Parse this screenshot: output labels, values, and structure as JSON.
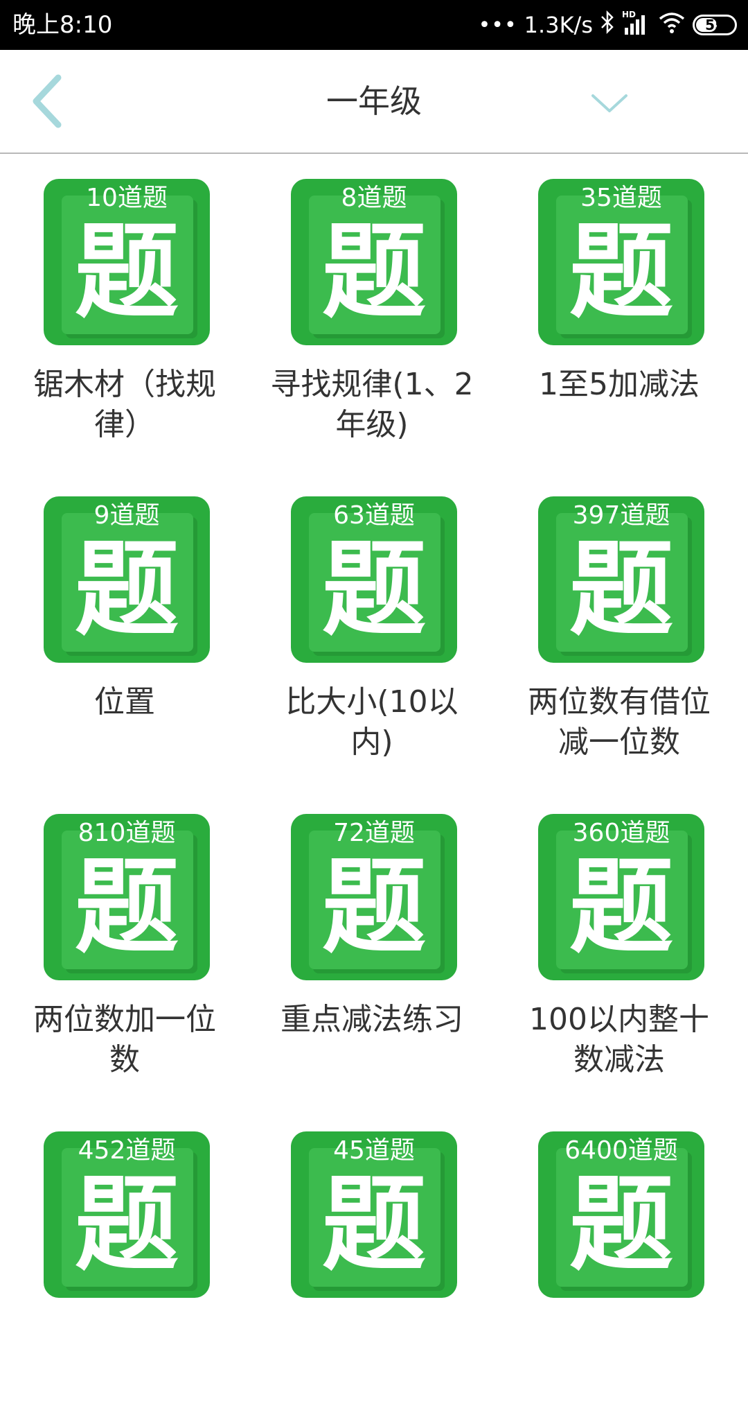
{
  "status_bar": {
    "time": "晚上8:10",
    "network_speed": "1.3K/s",
    "signal_label": "HD",
    "battery": "55",
    "battery_level": 0.55,
    "icons": [
      "signal-dots-icon",
      "bluetooth-icon",
      "cell-signal-icon",
      "wifi-icon",
      "battery-icon"
    ]
  },
  "header": {
    "title": "一年级",
    "back_icon": "chevron-left-icon",
    "dropdown_icon": "chevron-down-icon"
  },
  "colors": {
    "tile_green": "#2aac3d",
    "tile_inner": "#3cbb4e",
    "icon_accent": "#a6d8dc",
    "text": "#333333"
  },
  "tile_glyph": "题",
  "items": [
    {
      "count": "10道题",
      "label": "锯木材（找规律）"
    },
    {
      "count": "8道题",
      "label": "寻找规律(1、2年级)"
    },
    {
      "count": "35道题",
      "label": "1至5加减法"
    },
    {
      "count": "9道题",
      "label": "位置"
    },
    {
      "count": "63道题",
      "label": "比大小(10以内)"
    },
    {
      "count": "397道题",
      "label": "两位数有借位减一位数"
    },
    {
      "count": "810道题",
      "label": "两位数加一位数"
    },
    {
      "count": "72道题",
      "label": "重点减法练习"
    },
    {
      "count": "360道题",
      "label": "100以内整十数减法"
    },
    {
      "count": "452道题",
      "label": ""
    },
    {
      "count": "45道题",
      "label": ""
    },
    {
      "count": "6400道题",
      "label": ""
    }
  ]
}
